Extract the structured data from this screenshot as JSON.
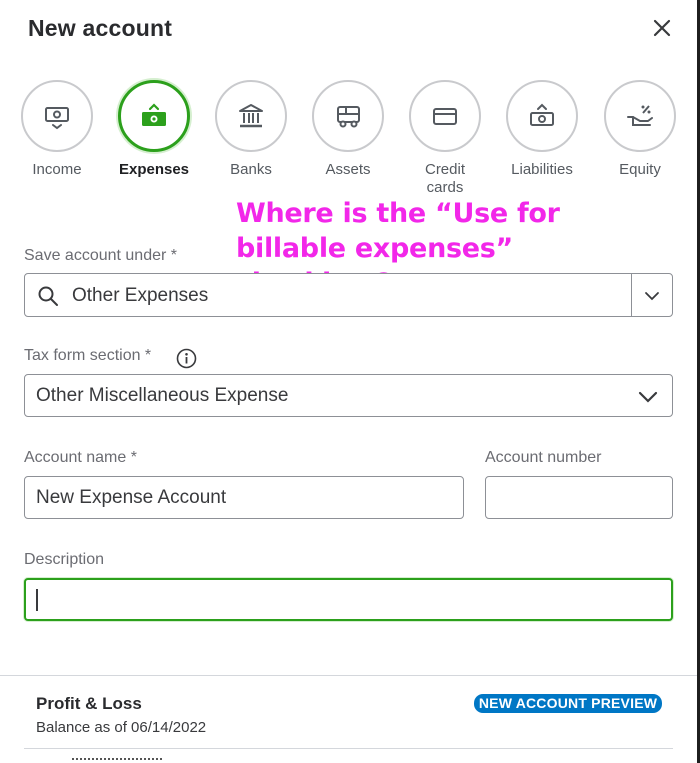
{
  "dialog": {
    "title": "New account",
    "close_icon": "close-icon"
  },
  "account_types": [
    {
      "label": "Income",
      "icon": "income-icon",
      "selected": false
    },
    {
      "label": "Expenses",
      "icon": "expenses-icon",
      "selected": true
    },
    {
      "label": "Banks",
      "icon": "bank-icon",
      "selected": false
    },
    {
      "label": "Assets",
      "icon": "assets-icon",
      "selected": false
    },
    {
      "label": "Credit cards",
      "icon": "credit-card-icon",
      "selected": false
    },
    {
      "label": "Liabilities",
      "icon": "liabilities-icon",
      "selected": false
    },
    {
      "label": "Equity",
      "icon": "equity-icon",
      "selected": false
    }
  ],
  "annotation": {
    "text": "Where is the “Use for billable expenses” checkbox?",
    "color": "#f227e9"
  },
  "form": {
    "save_under": {
      "label": "Save account under *",
      "value": "Other Expenses"
    },
    "tax_form": {
      "label": "Tax form section *",
      "value": "Other Miscellaneous Expense"
    },
    "account_name": {
      "label": "Account name *",
      "value": "New Expense Account"
    },
    "account_number": {
      "label": "Account number",
      "value": ""
    },
    "description": {
      "label": "Description",
      "value": ""
    }
  },
  "preview": {
    "title": "Profit & Loss",
    "subtitle": "Balance as of 06/14/2022",
    "badge": "NEW ACCOUNT PREVIEW"
  },
  "colors": {
    "accent_green": "#2ca01c",
    "badge_blue": "#0077c5"
  }
}
